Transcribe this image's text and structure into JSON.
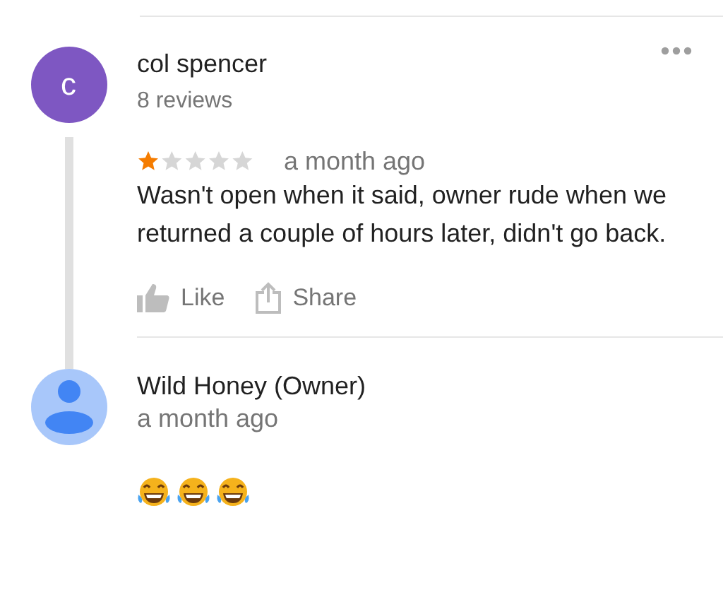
{
  "review": {
    "avatar_letter": "c",
    "author": "col spencer",
    "review_count": "8 reviews",
    "stars": 1,
    "time": "a month ago",
    "text": "Wasn't open when it said, owner rude when we returned a couple of hours later, didn't go back.",
    "actions": [
      {
        "kind": "like",
        "label": "Like"
      },
      {
        "kind": "share",
        "label": "Share"
      }
    ]
  },
  "owner_reply": {
    "author": "Wild Honey (Owner)",
    "time": "a month ago"
  }
}
